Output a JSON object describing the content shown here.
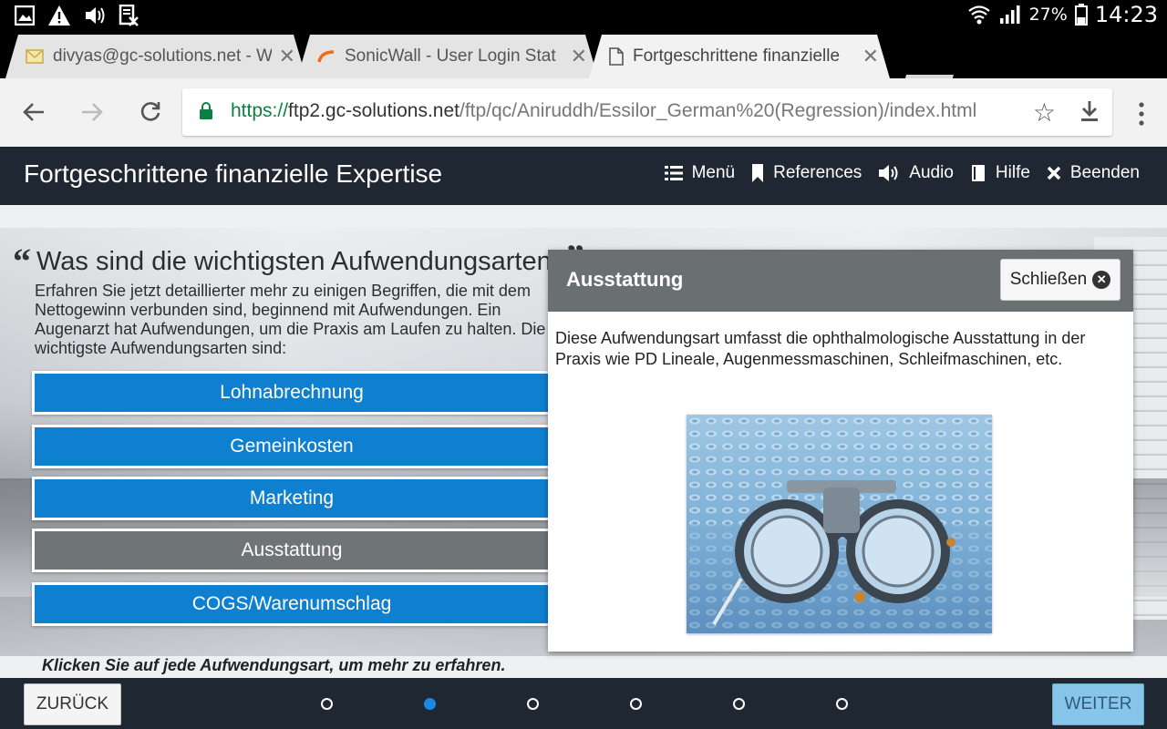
{
  "status_bar": {
    "battery_pct": "27%",
    "time": "14:23"
  },
  "tabs": [
    {
      "title": "divyas@gc-solutions.net - W",
      "icon": "mail-icon"
    },
    {
      "title": "SonicWall - User Login Stat",
      "icon": "sonicwall-icon"
    },
    {
      "title": "Fortgeschrittene finanzielle",
      "icon": "page-icon",
      "active": true
    }
  ],
  "address_bar": {
    "scheme": "https://",
    "host": "ftp2.gc-solutions.net",
    "path": "/ftp/qc/Aniruddh/Essilor_German%20(Regression)/index.html"
  },
  "course": {
    "title": "Fortgeschrittene finanzielle Expertise",
    "nav": {
      "menu": "Menü",
      "references": "References",
      "audio": "Audio",
      "help": "Hilfe",
      "exit": "Beenden"
    }
  },
  "content": {
    "question": "Was sind die wichtigsten Aufwendungsarten?",
    "intro": "Erfahren Sie jetzt detaillierter mehr zu einigen Begriffen, die mit dem Nettogewinn verbunden sind, beginnend mit Aufwendungen. Ein Augenarzt hat Aufwendungen, um die Praxis am Laufen zu halten. Die wichtigste Aufwendungsarten sind:",
    "choices": [
      {
        "label": "Lohnabrechnung",
        "selected": false
      },
      {
        "label": "Gemeinkosten",
        "selected": false
      },
      {
        "label": "Marketing",
        "selected": false
      },
      {
        "label": "Ausstattung",
        "selected": true
      },
      {
        "label": "COGS/Warenumschlag",
        "selected": false
      }
    ],
    "hint": "Klicken Sie auf jede Aufwendungsart, um mehr zu erfahren."
  },
  "popup": {
    "title": "Ausstattung",
    "close_label": "Schließen",
    "body": "Diese Aufwendungsart umfasst die ophthalmologische Ausstattung in der Praxis wie PD Lineale, Augenmessmaschinen, Schleifmaschinen, etc.",
    "image": "trial-frame-lens-kit-image"
  },
  "footer": {
    "back_label": "ZURÜCK",
    "next_label": "WEITER",
    "page_count": 6,
    "current_page": 2
  },
  "colors": {
    "header_bg": "#1f2733",
    "choice_blue": "#0f7fd0",
    "choice_selected": "#6f7477",
    "popup_header": "#6a6f72",
    "next_btn": "#87c6ea"
  }
}
